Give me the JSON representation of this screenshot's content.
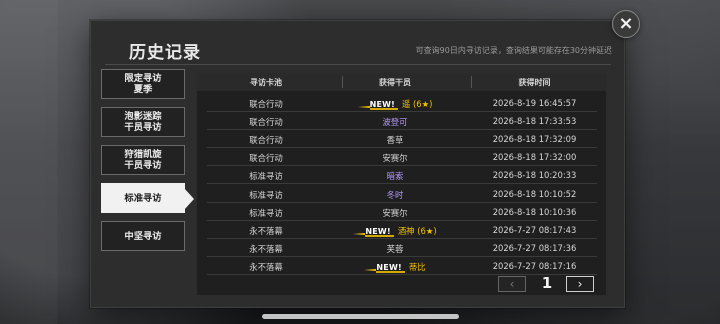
{
  "header": {
    "title": "历史记录",
    "notice": "可查询90日内寻访记录，查询结果可能存在30分钟延迟"
  },
  "tabs": [
    {
      "label": "限定寻访\n夏季",
      "selected": false
    },
    {
      "label": "泡影迷踪\n干员寻访",
      "selected": false
    },
    {
      "label": "狩猎凯旋\n干员寻访",
      "selected": false
    },
    {
      "label": "标准寻访",
      "selected": true
    },
    {
      "label": "中坚寻访",
      "selected": false
    }
  ],
  "table": {
    "headers": [
      "寻访卡池",
      "获得干员",
      "获得时间"
    ],
    "rows": [
      {
        "pool": "联合行动",
        "operator": "遥 (6★)",
        "time": "2026-8-19 16:45:57",
        "new": "NEW!",
        "color": "#f3c200"
      },
      {
        "pool": "联合行动",
        "operator": "波登可",
        "time": "2026-8-18 17:33:53",
        "new": "",
        "color": "#b89bff"
      },
      {
        "pool": "联合行动",
        "operator": "香草",
        "time": "2026-8-18 17:32:09",
        "new": "",
        "color": "#d7d7d7"
      },
      {
        "pool": "联合行动",
        "operator": "安赛尔",
        "time": "2026-8-18 17:32:00",
        "new": "",
        "color": "#d7d7d7"
      },
      {
        "pool": "标准寻访",
        "operator": "暗索",
        "time": "2026-8-18 10:20:33",
        "new": "",
        "color": "#b89bff"
      },
      {
        "pool": "标准寻访",
        "operator": "冬时",
        "time": "2026-8-18 10:10:52",
        "new": "",
        "color": "#b89bff"
      },
      {
        "pool": "标准寻访",
        "operator": "安赛尔",
        "time": "2026-8-18 10:10:36",
        "new": "",
        "color": "#d7d7d7"
      },
      {
        "pool": "永不落幕",
        "operator": "酒神 (6★)",
        "time": "2026-7-27 08:17:43",
        "new": "NEW!",
        "color": "#f3c200"
      },
      {
        "pool": "永不落幕",
        "operator": "芙蓉",
        "time": "2026-7-27 08:17:36",
        "new": "",
        "color": "#d7d7d7"
      },
      {
        "pool": "永不落幕",
        "operator": "蒂比",
        "time": "2026-7-27 08:17:16",
        "new": "NEW!",
        "color": "#f3c200"
      }
    ]
  },
  "pager": {
    "page": "1",
    "prev_icon": "chevron-left-icon",
    "next_icon": "chevron-right-icon"
  },
  "icons": {
    "close": "close-icon"
  },
  "colors": {
    "panel_bg": "#2d2d2d",
    "accent_gold": "#f3c200",
    "accent_purple": "#b89bff"
  }
}
